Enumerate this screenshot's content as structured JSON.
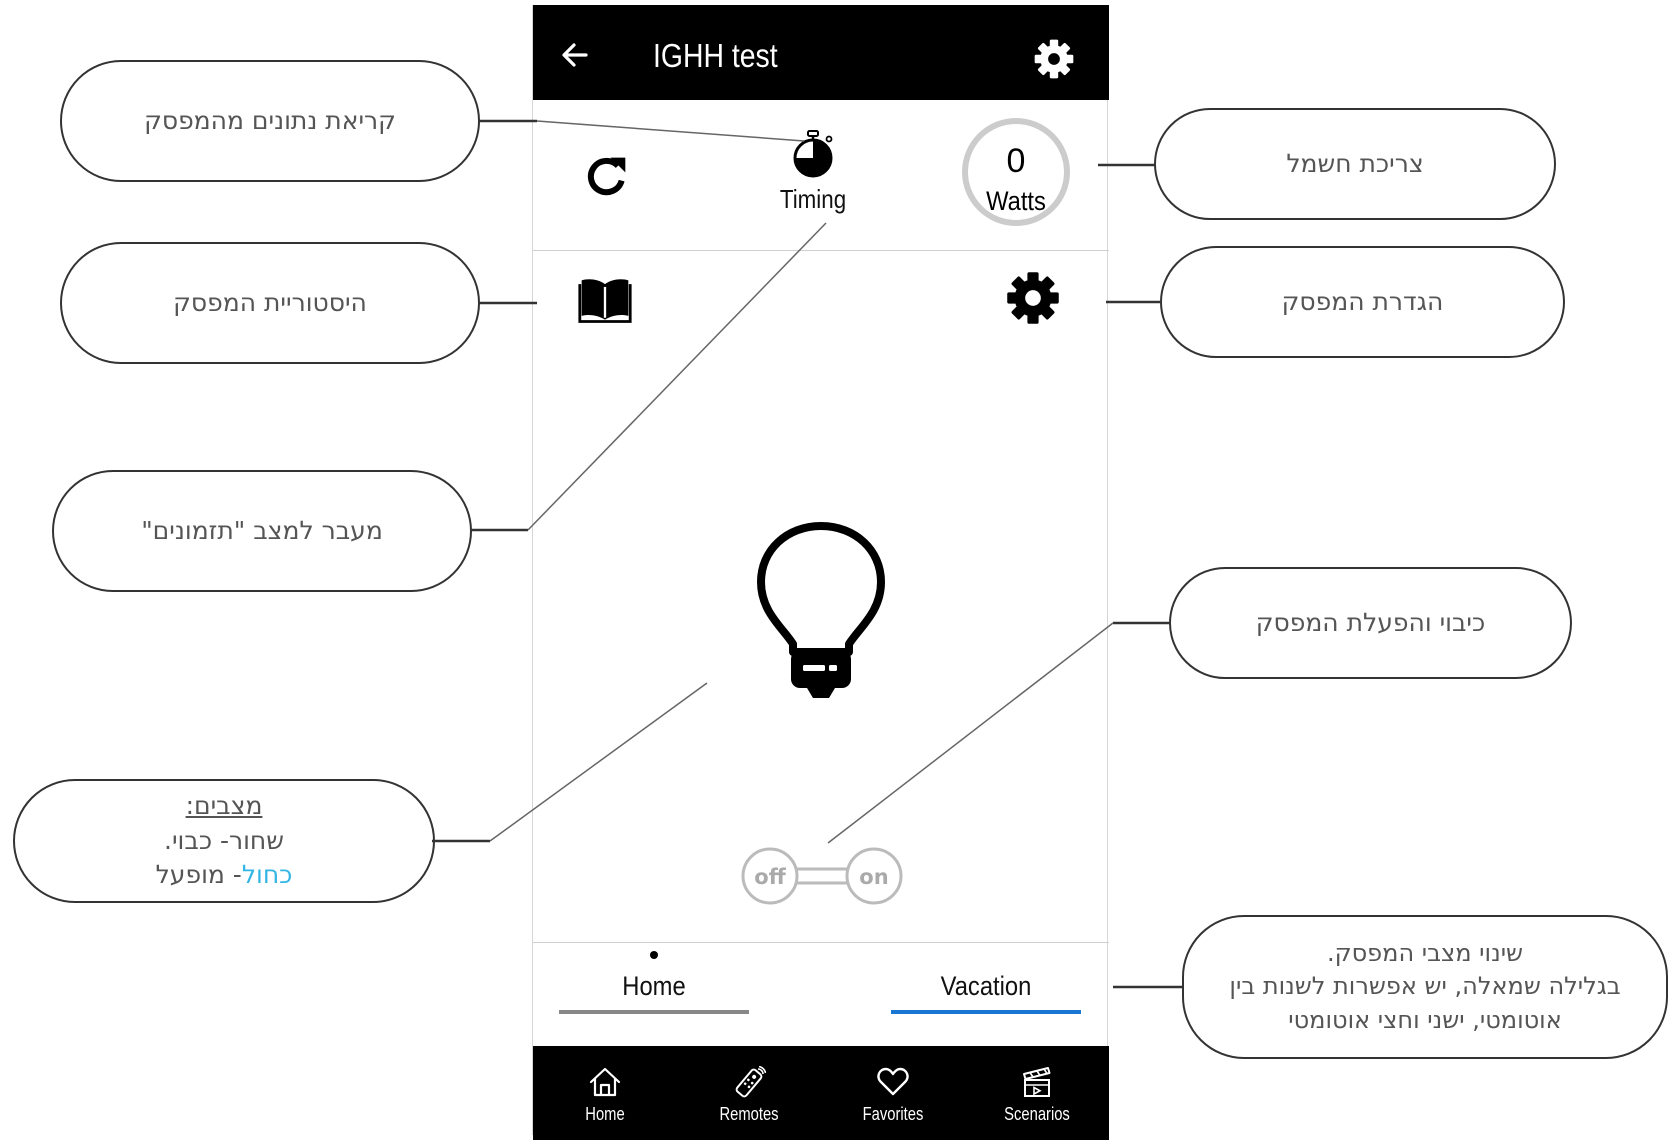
{
  "app": {
    "title": "IGHH test",
    "timing_label": "Timing",
    "power_value": "0",
    "power_unit": "Watts",
    "toggle_off": "off",
    "toggle_on": "on",
    "modes": [
      {
        "label": "Home",
        "color": "#888888"
      },
      {
        "label": "Vacation",
        "color": "#1976d2"
      }
    ],
    "nav": [
      {
        "label": "Home",
        "icon": "home-icon"
      },
      {
        "label": "Remotes",
        "icon": "remote-icon"
      },
      {
        "label": "Favorites",
        "icon": "heart-icon"
      },
      {
        "label": "Scenarios",
        "icon": "clapperboard-icon"
      }
    ]
  },
  "callouts": {
    "read_data": "קריאת נתונים מהמפסק",
    "history": "היסטוריית המפסק",
    "timing_mode": "מעבר למצב \"תזמונים\"",
    "states_title": "מצבים:",
    "states_black": "שחור- כבוי.",
    "states_blue_word": "כחול",
    "states_blue_rest": "- מופעל",
    "power": "צריכת חשמל",
    "settings": "הגדרת המפסק",
    "toggle": "כיבוי והפעלת המפסק",
    "modes_line1": "שינוי מצבי המפסק.",
    "modes_line2": "בגלילה שמאלה, יש אפשרות לשנות בין",
    "modes_line3": "אוטומטי, ישני וחצי אוטומטי"
  },
  "colors": {
    "topbar": "#000000",
    "mode_active": "#1976d2",
    "on_state": "#33b5e5",
    "toggle": "#bbbbbb"
  }
}
